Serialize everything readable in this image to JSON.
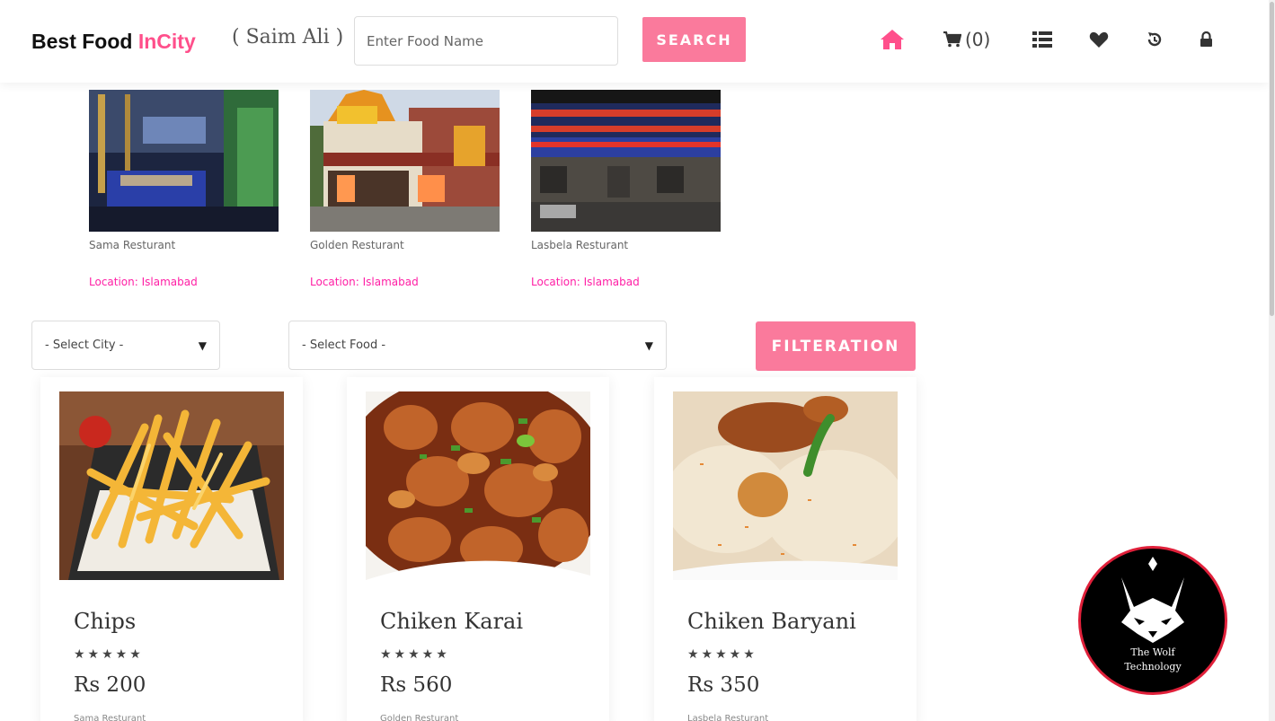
{
  "header": {
    "brand_main": "Best Food",
    "brand_accent": "InCity",
    "owner": "( Saim Ali )",
    "search_placeholder": "Enter Food Name",
    "search_button": "SEARCH",
    "cart_count": "(0)",
    "accent_color": "#ff4f8b",
    "nav_icons": [
      "home-icon",
      "cart-icon",
      "list-icon",
      "heart-icon",
      "history-icon",
      "lock-icon"
    ]
  },
  "restaurants": [
    {
      "name": "Sama Resturant",
      "location": "Location: Islamabad"
    },
    {
      "name": "Golden Resturant",
      "location": "Location: Islamabad"
    },
    {
      "name": "Lasbela Resturant",
      "location": "Location: Islamabad"
    }
  ],
  "filters": {
    "city_select": "- Select City -",
    "food_select": "- Select Food -",
    "filter_button": "FILTERATION"
  },
  "foods": [
    {
      "name": "Chips",
      "rating": "★★★★★",
      "price": "Rs 200",
      "restaurant": "Sama Resturant"
    },
    {
      "name": "Chiken Karai",
      "rating": "★★★★★",
      "price": "Rs 560",
      "restaurant": "Golden Resturant"
    },
    {
      "name": "Chiken Baryani",
      "rating": "★★★★★",
      "price": "Rs 350",
      "restaurant": "Lasbela Resturant"
    }
  ],
  "badge": {
    "line1": "The Wolf",
    "line2": "Technology"
  },
  "colors": {
    "button": "#fa7a9c",
    "location": "#ff1fa5"
  }
}
